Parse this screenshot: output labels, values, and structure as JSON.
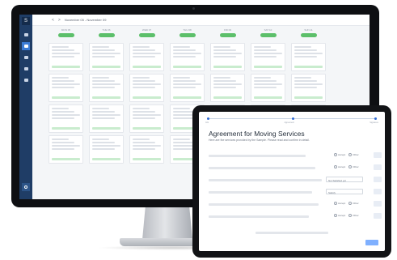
{
  "monitor": {
    "app": {
      "logo_text": "S",
      "date_range": "November 05 - November 09",
      "prev_label": "<",
      "next_label": ">",
      "columns": [
        {
          "day": "MON 05",
          "cards": 4
        },
        {
          "day": "TUE 06",
          "cards": 4
        },
        {
          "day": "WED 07",
          "cards": 4
        },
        {
          "day": "THU 08",
          "cards": 4
        },
        {
          "day": "FRI 09",
          "cards": 4
        },
        {
          "day": "SAT 10",
          "cards": 4
        },
        {
          "day": "SUN 11",
          "cards": 4
        }
      ],
      "card_status_color": "#5cbf6a",
      "sidebar_active_color": "#3a7bd5"
    }
  },
  "tablet": {
    "progress_steps": [
      "Info",
      "Agreement",
      "Signature"
    ],
    "title": "Agreement for Moving Services",
    "subtitle": "Here are the services provided by the Sample. Please read and confirm in detail.",
    "rows": [
      {
        "type": "yesno",
        "yes": "Accept",
        "no": "Other"
      },
      {
        "type": "yesno",
        "yes": "Accept",
        "no": "Other"
      },
      {
        "type": "select",
        "value": "Not Satisfied yet"
      },
      {
        "type": "select",
        "value": "Satisfy"
      },
      {
        "type": "yesno",
        "yes": "Accept",
        "no": "Other"
      },
      {
        "type": "yesno",
        "yes": "Accept",
        "no": "Other"
      }
    ],
    "accent_color": "#2f6bd6"
  }
}
